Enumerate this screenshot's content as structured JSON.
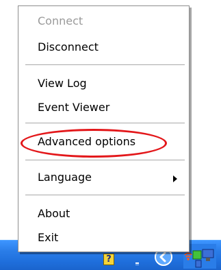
{
  "menu": {
    "items": [
      {
        "label": "Connect",
        "enabled": false
      },
      {
        "label": "Disconnect",
        "enabled": true
      },
      {
        "label": "View Log",
        "enabled": true
      },
      {
        "label": "Event Viewer",
        "enabled": true
      },
      {
        "label": "Advanced options",
        "enabled": true,
        "highlighted": true
      },
      {
        "label": "Language",
        "enabled": true,
        "has_submenu": true
      },
      {
        "label": "About",
        "enabled": true
      },
      {
        "label": "Exit",
        "enabled": true
      }
    ],
    "highlight_color": "#e3171a",
    "submenu_arrow_icon": "triangle-right-icon"
  },
  "taskbar": {
    "color": "#2a7de8",
    "tray_icons": [
      {
        "name": "help-icon",
        "glyph": "?"
      },
      {
        "name": "app-icon"
      },
      {
        "name": "back-arrow-icon"
      },
      {
        "name": "network-icon"
      }
    ]
  }
}
